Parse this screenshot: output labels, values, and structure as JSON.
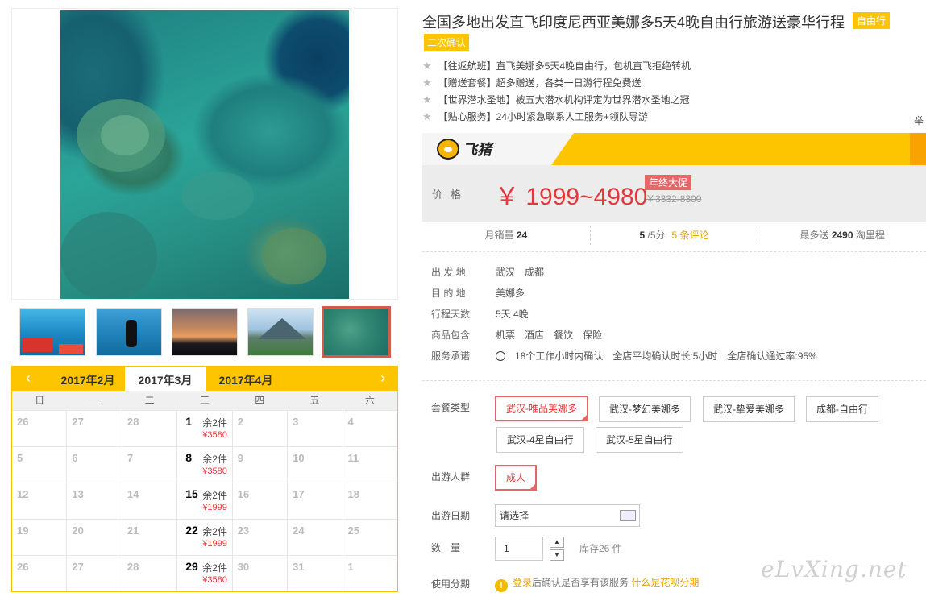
{
  "product": {
    "title": "全国多地出发直飞印度尼西亚美娜多5天4晚自由行旅游送豪华行程",
    "tag_free": "自由行",
    "tag_confirm": "二次确认",
    "features": [
      "【往返航班】直飞美娜多5天4晚自由行，包机直飞拒绝转机",
      "【赠送套餐】超多赠送，各类一日游行程免费送",
      "【世界潜水圣地】被五大潜水机构评定为世界潜水圣地之冠",
      "【贴心服务】24小时紧急联系人工服务+领队导游"
    ],
    "cut_text": "举"
  },
  "brand": {
    "name": "飞猪",
    "icon": "fliggy-pig-icon",
    "colors": {
      "yellow": "#fdc400",
      "orange": "#f8a300"
    }
  },
  "price": {
    "label": "价格",
    "value": "￥ 1999~4980",
    "promo": "年终大促",
    "old_price": "￥3332-8300",
    "color": "#e4393c"
  },
  "stats": {
    "sales_label": "月销量",
    "sales_value": "24",
    "rating_value": "5",
    "rating_suffix": "/5分",
    "reviews_link": "5 条评论",
    "points_prefix": "最多送",
    "points_value": "2490",
    "points_suffix": "淘里程"
  },
  "info": {
    "departure_label": "出 发 地",
    "departure": [
      "武汉",
      "成都"
    ],
    "destination_label": "目 的 地",
    "destination": "美娜多",
    "days_label": "行程天数",
    "days": "5天 4晚",
    "includes_label": "商品包含",
    "includes": [
      "机票",
      "酒店",
      "餐饮",
      "保险"
    ],
    "service_label": "服务承诺",
    "service": [
      "18个工作小时内确认",
      "全店平均确认时长:5小时",
      "全店确认通过率:95%"
    ]
  },
  "options": {
    "package_label": "套餐类型",
    "packages": [
      "武汉-唯品美娜多",
      "武汉-梦幻美娜多",
      "武汉-挚爱美娜多",
      "成都-自由行",
      "武汉-4星自由行",
      "武汉-5星自由行"
    ],
    "people_label": "出游人群",
    "people": [
      "成人"
    ],
    "date_label": "出游日期",
    "date_placeholder": "请选择",
    "qty_label": "数　量",
    "qty_value": "1",
    "stock": "库存26 件",
    "installment_label": "使用分期",
    "installment_login": "登录",
    "installment_text": "后确认是否享有该服务",
    "installment_link": "什么是花呗分期"
  },
  "calendar": {
    "months": [
      "2017年2月",
      "2017年3月",
      "2017年4月"
    ],
    "active_month": "2017年3月",
    "weekdays": [
      "日",
      "一",
      "二",
      "三",
      "四",
      "五",
      "六"
    ],
    "rows": [
      [
        {
          "d": "26"
        },
        {
          "d": "27"
        },
        {
          "d": "28"
        },
        {
          "d": "1",
          "stock": "余2件",
          "price": "¥3580"
        },
        {
          "d": "2"
        },
        {
          "d": "3"
        },
        {
          "d": "4"
        }
      ],
      [
        {
          "d": "5"
        },
        {
          "d": "6"
        },
        {
          "d": "7"
        },
        {
          "d": "8",
          "stock": "余2件",
          "price": "¥3580"
        },
        {
          "d": "9"
        },
        {
          "d": "10"
        },
        {
          "d": "11"
        }
      ],
      [
        {
          "d": "12"
        },
        {
          "d": "13"
        },
        {
          "d": "14"
        },
        {
          "d": "15",
          "stock": "余2件",
          "price": "¥1999"
        },
        {
          "d": "16"
        },
        {
          "d": "17"
        },
        {
          "d": "18"
        }
      ],
      [
        {
          "d": "19"
        },
        {
          "d": "20"
        },
        {
          "d": "21"
        },
        {
          "d": "22",
          "stock": "余2件",
          "price": "¥1999"
        },
        {
          "d": "23"
        },
        {
          "d": "24"
        },
        {
          "d": "25"
        }
      ],
      [
        {
          "d": "26"
        },
        {
          "d": "27"
        },
        {
          "d": "28"
        },
        {
          "d": "29",
          "stock": "余2件",
          "price": "¥3580"
        },
        {
          "d": "30"
        },
        {
          "d": "31"
        },
        {
          "d": "1"
        }
      ]
    ]
  },
  "watermark": "eLvXing.net"
}
